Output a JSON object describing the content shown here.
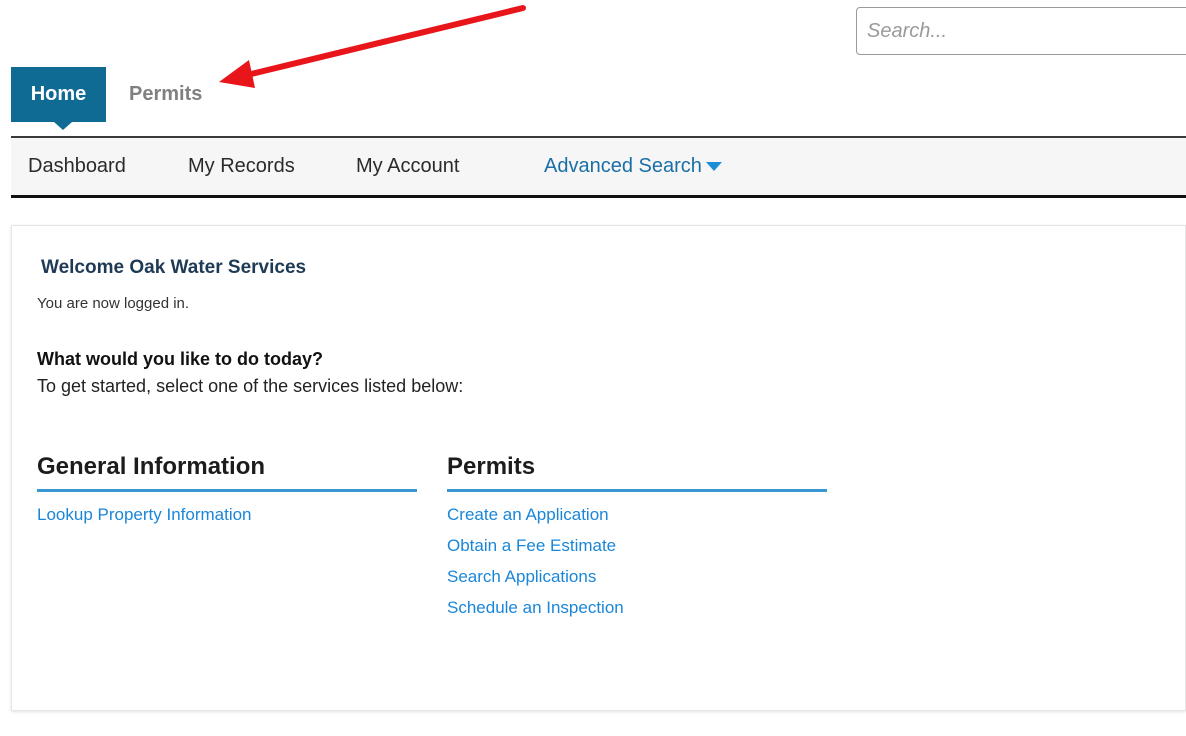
{
  "search": {
    "placeholder": "Search..."
  },
  "top_tabs": {
    "home_label": "Home",
    "permits_label": "Permits"
  },
  "nav": {
    "items": [
      {
        "label": "Dashboard"
      },
      {
        "label": "My Records"
      },
      {
        "label": "My Account"
      },
      {
        "label": "Advanced Search"
      }
    ]
  },
  "welcome": {
    "title": "Welcome Oak Water Services",
    "status": "You are now logged in.",
    "question": "What would you like to do today?",
    "instruction": "To get started, select one of the services listed below:"
  },
  "sections": [
    {
      "heading": "General Information",
      "links": [
        "Lookup Property Information"
      ]
    },
    {
      "heading": "Permits",
      "links": [
        "Create an Application",
        "Obtain a Fee Estimate",
        "Search Applications",
        "Schedule an Inspection"
      ]
    }
  ],
  "colors": {
    "home_tab_bg": "#0f6b94",
    "link_blue": "#1a86d8",
    "section_rule": "#3a97d4",
    "annotation_arrow": "#e8151a"
  },
  "icons": {
    "nav_dropdown": "caret-down-icon",
    "annotation": "red-arrow-icon"
  }
}
